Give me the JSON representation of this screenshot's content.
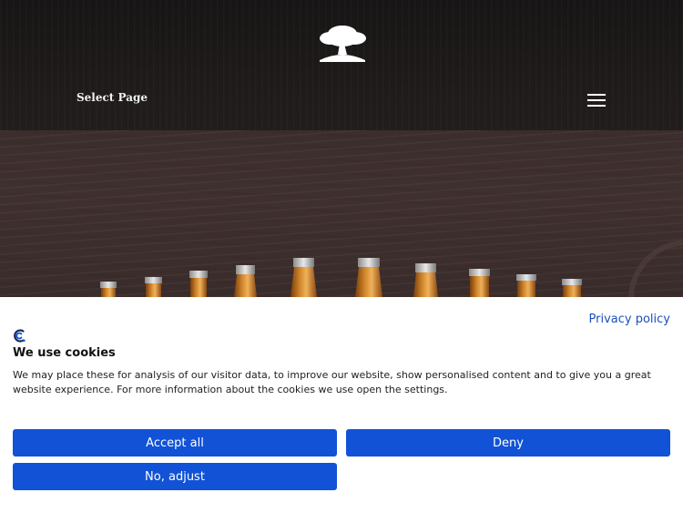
{
  "header": {
    "select_page_label": "Select Page"
  },
  "cookie_banner": {
    "privacy_link": "Privacy policy",
    "title": "We use cookies",
    "description": "We may place these for analysis of our visitor data, to improve our website, show personalised content and to give you a great website experience. For more information about the cookies we use open the settings.",
    "buttons": {
      "accept": "Accept all",
      "deny": "Deny",
      "adjust": "No, adjust"
    }
  },
  "colors": {
    "button_blue": "#1152d6",
    "link_blue": "#1a4fbf",
    "header_dark": "#1d1a19",
    "wood_brown": "#3f302f",
    "bottle_amber": "#b86a1c"
  },
  "icons": {
    "logo": "tree-logo-icon",
    "menu": "hamburger-menu-icon",
    "brand": "cookie-consent-brand-icon"
  }
}
